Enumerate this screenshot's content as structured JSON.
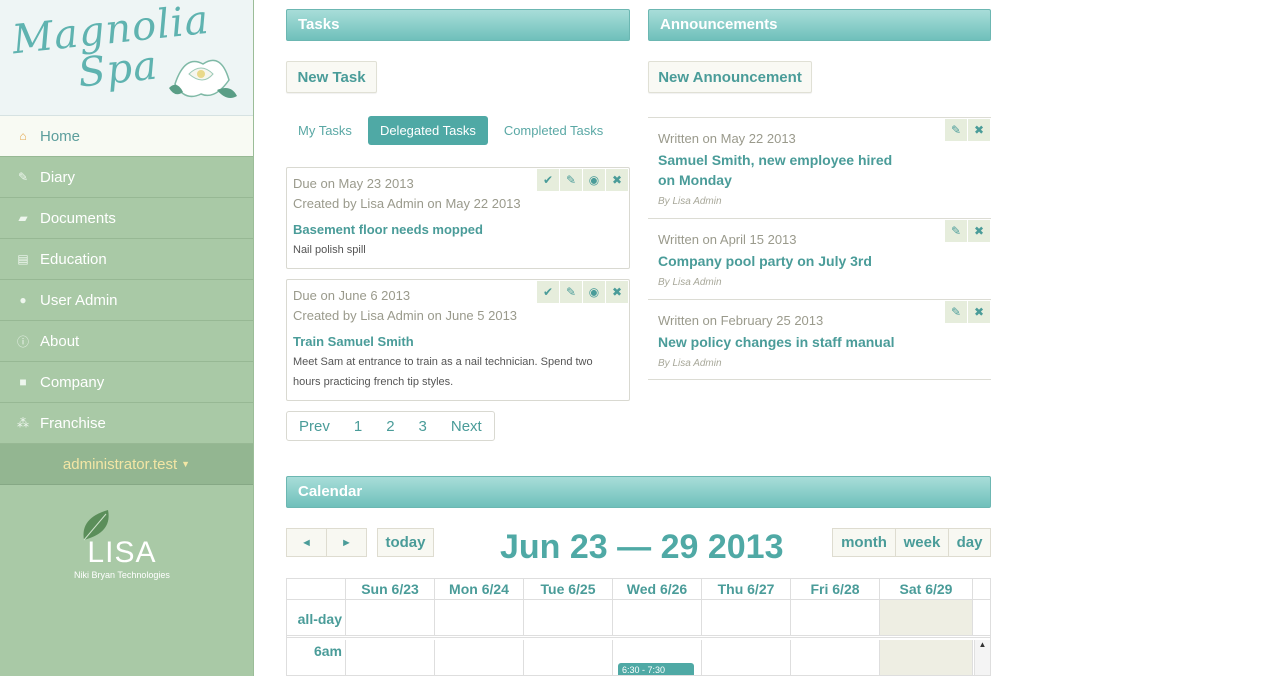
{
  "sidebar": {
    "logo": {
      "line1": "Magnolia",
      "line2": "Spa"
    },
    "items": [
      {
        "label": "Home",
        "icon": "home-icon",
        "active": true
      },
      {
        "label": "Diary",
        "icon": "edit-icon"
      },
      {
        "label": "Documents",
        "icon": "folder-open-icon"
      },
      {
        "label": "Education",
        "icon": "book-icon"
      },
      {
        "label": "User Admin",
        "icon": "user-icon"
      },
      {
        "label": "About",
        "icon": "info-icon"
      },
      {
        "label": "Company",
        "icon": "briefcase-icon"
      },
      {
        "label": "Franchise",
        "icon": "sitemap-icon"
      }
    ],
    "user": "administrator.test",
    "brand": {
      "name": "LISA",
      "company": "Niki Bryan Technologies"
    }
  },
  "tasks": {
    "header": "Tasks",
    "new_button": "New Task",
    "tabs": [
      "My Tasks",
      "Delegated Tasks",
      "Completed Tasks"
    ],
    "active_tab": "Delegated Tasks",
    "items": [
      {
        "due": "Due on May 23 2013",
        "created": "Created by Lisa Admin on May 22 2013",
        "title": "Basement floor needs mopped",
        "desc": "Nail polish spill"
      },
      {
        "due": "Due on June 6 2013",
        "created": "Created by Lisa Admin on June 5 2013",
        "title": "Train Samuel Smith",
        "desc": "Meet Sam at entrance to train as a nail technician. Spend two hours practicing french tip styles."
      }
    ],
    "pager": [
      "Prev",
      "1",
      "2",
      "3",
      "Next"
    ]
  },
  "announcements": {
    "header": "Announcements",
    "new_button": "New Announcement",
    "items": [
      {
        "written": "Written on May 22 2013",
        "title": "Samuel Smith, new employee hired on Monday",
        "by": "By Lisa Admin"
      },
      {
        "written": "Written on April 15 2013",
        "title": "Company pool party on July 3rd",
        "by": "By Lisa Admin"
      },
      {
        "written": "Written on February 25 2013",
        "title": "New policy changes in staff manual",
        "by": "By Lisa Admin"
      }
    ]
  },
  "calendar": {
    "header": "Calendar",
    "prev": "◄",
    "next": "►",
    "today": "today",
    "title": "Jun 23 — 29 2013",
    "views": [
      "month",
      "week",
      "day"
    ],
    "days": [
      "Sun 6/23",
      "Mon 6/24",
      "Tue 6/25",
      "Wed 6/26",
      "Thu 6/27",
      "Fri 6/28",
      "Sat 6/29"
    ],
    "allday": "all-day",
    "time": "6am",
    "event": "6:30 - 7:30"
  },
  "colors": {
    "teal": "#4fa9a5",
    "sidebar": "#a9c9a6"
  }
}
